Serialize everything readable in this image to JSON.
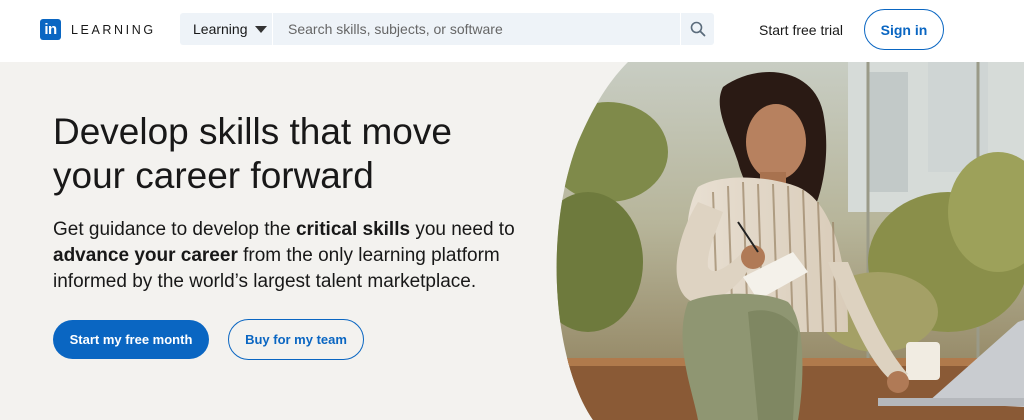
{
  "brand": {
    "logo_letters": "in",
    "wordmark": "LEARNING",
    "accent": "#0a66c2"
  },
  "search": {
    "category_label": "Learning",
    "placeholder": "Search skills, subjects, or software",
    "icon": "search-icon"
  },
  "nav": {
    "trial_label": "Start free trial",
    "signin_label": "Sign in"
  },
  "hero": {
    "title_line1": "Develop skills that move",
    "title_line2": "your career forward",
    "sub_part1": "Get guidance to develop the ",
    "sub_bold1": "critical skills",
    "sub_part2": " you need to ",
    "sub_bold2": "advance your career",
    "sub_part3": " from the only learning platform informed by the world’s largest talent marketplace.",
    "primary_cta": "Start my free month",
    "secondary_cta": "Buy for my team",
    "background": "#f3f2ef"
  }
}
